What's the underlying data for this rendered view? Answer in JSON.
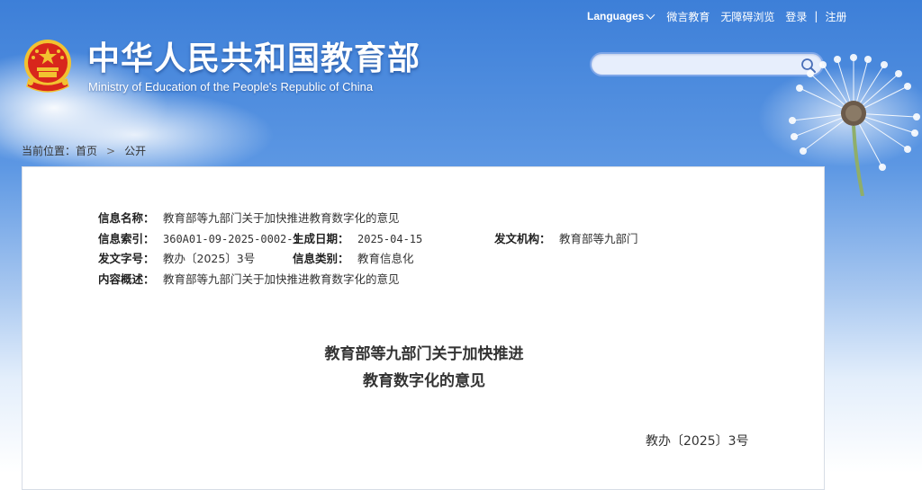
{
  "header": {
    "title": "中华人民共和国教育部",
    "subtitle": "Ministry of Education of the People's Republic of China",
    "emblem_icon": "national-emblem-icon"
  },
  "topnav": {
    "languages": "Languages",
    "weiyan": "微言教育",
    "accessible": "无障碍浏览",
    "login": "登录",
    "separator": "|",
    "register": "注册"
  },
  "search": {
    "placeholder": "",
    "icon": "search-icon"
  },
  "breadcrumb": {
    "label": "当前位置：",
    "home": "首页",
    "separator": ">",
    "current": "公开"
  },
  "info": {
    "name_label": "信息名称：",
    "name_value": "教育部等九部门关于加快推进教育数字化的意见",
    "index_label": "信息索引：",
    "index_value": "360A01-09-2025-0002-1",
    "date_label": "生成日期：",
    "date_value": "2025-04-15",
    "issuer_label": "发文机构：",
    "issuer_value": "教育部等九部门",
    "docno_label": "发文字号：",
    "docno_value": "教办〔2025〕3号",
    "category_label": "信息类别：",
    "category_value": "教育信息化",
    "summary_label": "内容概述：",
    "summary_value": "教育部等九部门关于加快推进教育数字化的意见"
  },
  "document": {
    "title_line1": "教育部等九部门关于加快推进",
    "title_line2": "教育数字化的意见",
    "number": "教办〔2025〕3号"
  },
  "colors": {
    "sky_top": "#3d7fd8",
    "sky_bottom": "#ffffff",
    "emblem_red": "#d8261c",
    "emblem_gold": "#f2c230",
    "search_border": "#7ea6e8"
  }
}
